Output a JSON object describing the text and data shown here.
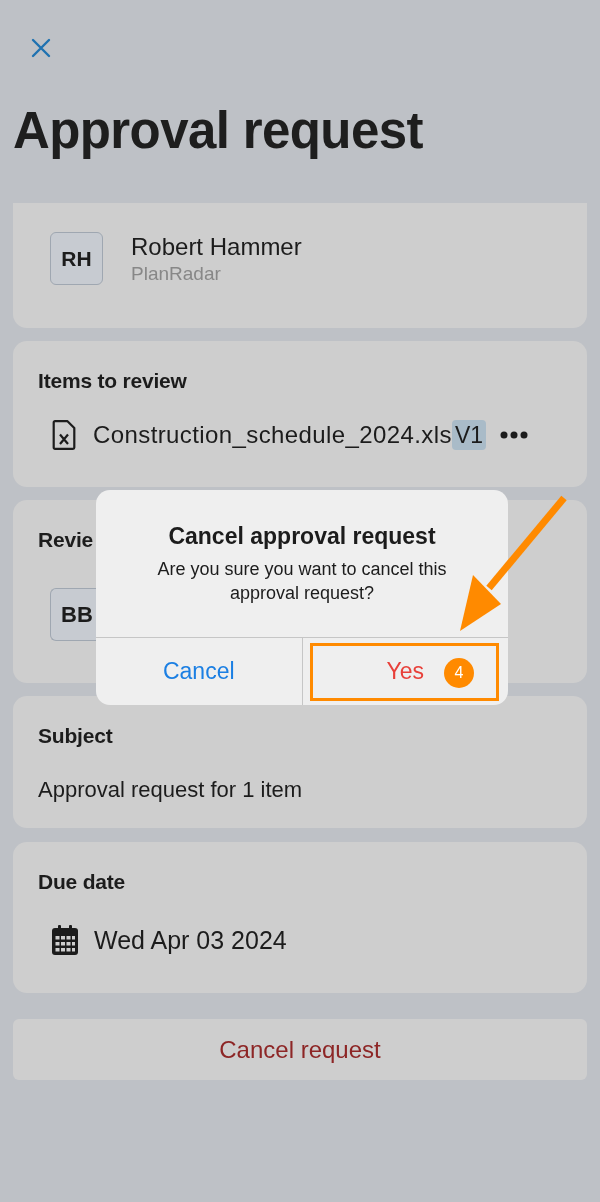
{
  "header": {
    "title": "Approval request"
  },
  "cards": [
    {
      "kind": "person",
      "initials": "RH",
      "name": "Robert Hammer",
      "company": "PlanRadar"
    },
    {
      "kind": "files",
      "heading": "Items to review",
      "files": [
        {
          "name": "Construction_schedule_2024.xls",
          "version": "V1"
        }
      ]
    },
    {
      "kind": "people",
      "heading": "Revie",
      "people": [
        {
          "initials": "BB"
        }
      ]
    },
    {
      "kind": "text",
      "heading": "Subject",
      "text": "Approval request for 1 item"
    },
    {
      "kind": "date",
      "heading": "Due date",
      "date": "Wed Apr 03 2024"
    }
  ],
  "cancel_button": {
    "label": "Cancel request"
  },
  "dialog": {
    "title": "Cancel approval request",
    "message": "Are you sure you want to cancel this approval request?",
    "buttons": [
      {
        "label": "Cancel",
        "kind": "default"
      },
      {
        "label": "Yes",
        "kind": "destructive"
      }
    ]
  },
  "annotation": {
    "step": "4"
  }
}
